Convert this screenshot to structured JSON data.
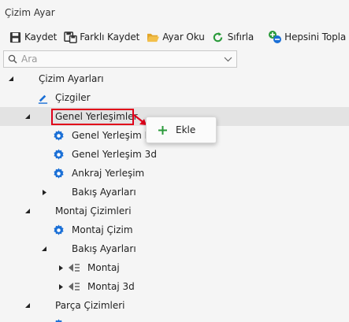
{
  "window": {
    "title": "Çizim Ayar"
  },
  "toolbar": {
    "save_label": "Kaydet",
    "save_as_label": "Farklı Kaydet",
    "open_label": "Ayar Oku",
    "reset_label": "Sıfırla",
    "collapse_all_label": "Hepsini Topla"
  },
  "search": {
    "placeholder": "Ara",
    "value": ""
  },
  "tree": {
    "root": "Çizim Ayarları",
    "lines": "Çizgiler",
    "general_layouts": "Genel Yerleşimler",
    "general_layout_pla": "Genel Yerleşim Pla",
    "general_layout_3d": "Genel Yerleşim 3d",
    "anchor_layout": "Ankraj Yerleşim",
    "view_settings_1": "Bakış Ayarları",
    "assembly_drawings": "Montaj Çizimleri",
    "assembly_drawing": "Montaj Çizim",
    "view_settings_2": "Bakış Ayarları",
    "assembly": "Montaj",
    "assembly_3d": "Montaj 3d",
    "part_drawings": "Parça Çizimleri"
  },
  "context_menu": {
    "add_label": "Ekle"
  },
  "colors": {
    "highlight_box": "#e0001a",
    "gear_icon": "#1a6fd6",
    "reset_icon": "#2a9a3a",
    "add_icon": "#2a9a3a"
  }
}
